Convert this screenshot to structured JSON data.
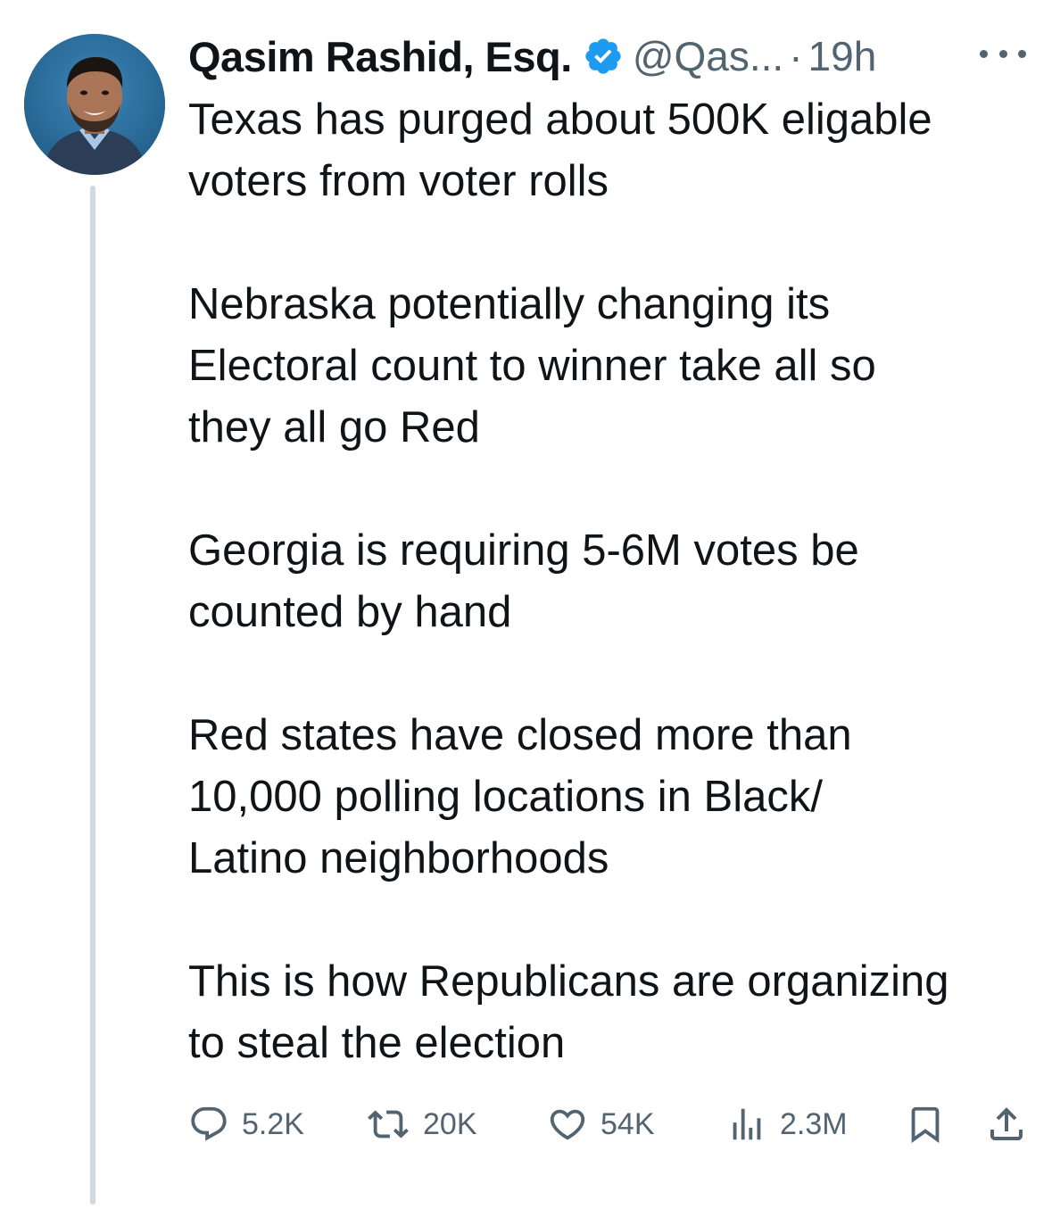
{
  "tweet": {
    "author": {
      "display_name": "Qasim Rashid, Esq.",
      "handle": "@Qas...",
      "verified_icon": "verified-badge-icon"
    },
    "separator": "·",
    "time": "19h",
    "paragraphs": [
      [
        "Texas has purged about 500K eligable",
        "voters from voter rolls"
      ],
      [
        "Nebraska potentially changing its",
        "Electoral count to winner take all so",
        "they all go Red"
      ],
      [
        "Georgia is requiring 5-6M votes be",
        "counted by hand"
      ],
      [
        "Red states have closed more than",
        "10,000 polling locations in Black/",
        "Latino neighborhoods"
      ],
      [
        "This is how Republicans are organizing",
        "to steal the election"
      ]
    ],
    "metrics": {
      "replies": "5.2K",
      "reposts": "20K",
      "likes": "54K",
      "views": "2.3M"
    }
  },
  "colors": {
    "text": "#0f1419",
    "secondary": "#536471",
    "verified": "#1d9bf0",
    "thread_line": "#cfd9de"
  }
}
